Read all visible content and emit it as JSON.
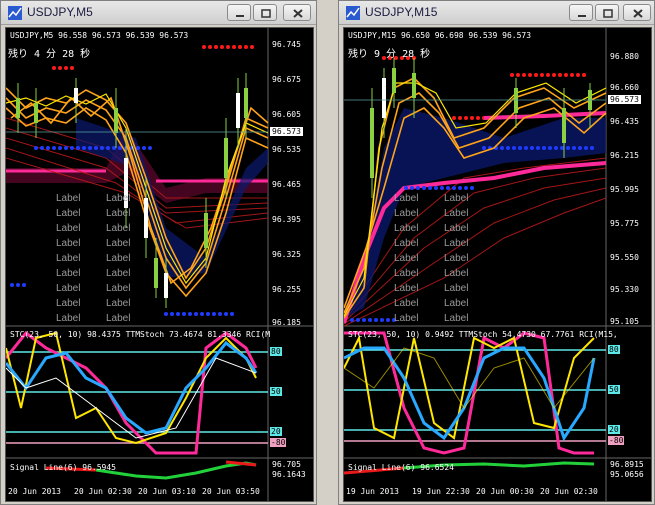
{
  "left": {
    "window_title": "USDJPY,M5",
    "chart_header": "USDJPY,M5  96.558 96.573 96.539 96.573",
    "remaining_time": "残り 4 分 28 秒",
    "price_scale": [
      "96.745",
      "96.675",
      "96.605",
      "96.573",
      "96.535",
      "96.465",
      "96.395",
      "96.325",
      "96.255",
      "96.185"
    ],
    "current_price": "96.573",
    "indicator_header": "STC(23, 50, 10) 98.4375  TTMStoch 73.4674 81.3346  RCI(M",
    "osc_levels": [
      "80",
      "50",
      "20",
      "-80"
    ],
    "signal_header": "Signal Line(6) 96.5945",
    "signal_values": [
      "96.705",
      "96.1643"
    ],
    "time_axis": [
      "20 Jun 2013",
      "20 Jun 02:30",
      "20 Jun 03:10",
      "20 Jun 03:50"
    ],
    "labels": [
      "Label",
      "Label",
      "Label",
      "Label",
      "Label",
      "Label",
      "Label",
      "Label",
      "Label",
      "Label",
      "Label",
      "Label",
      "Label",
      "Label",
      "Label",
      "Label",
      "Label",
      "Label"
    ]
  },
  "right": {
    "window_title": "USDJPY,M15",
    "chart_header": "USDJPY,M15  96.650 96.698 96.539 96.573",
    "remaining_time": "残り 9 分 28 秒",
    "price_scale": [
      "96.880",
      "96.660",
      "96.573",
      "96.435",
      "96.215",
      "95.995",
      "95.775",
      "95.550",
      "95.330",
      "95.105"
    ],
    "current_price": "96.573",
    "indicator_header": "STC(23, 50, 10) 0.9492  TTMStoch 54.4730 67.7761  RCI(M15,",
    "osc_levels": [
      "80",
      "50",
      "20",
      "-80"
    ],
    "signal_header": "Signal Line(6) 96.6524",
    "signal_values": [
      "96.8915",
      "95.0656"
    ],
    "time_axis": [
      "19 Jun 2013",
      "19 Jun 22:30",
      "20 Jun 00:30",
      "20 Jun 02:30"
    ],
    "labels": [
      "Label",
      "Label",
      "Label",
      "Label",
      "Label",
      "Label",
      "Label",
      "Label",
      "Label",
      "Label",
      "Label",
      "Label",
      "Label",
      "Label",
      "Label",
      "Label",
      "Label",
      "Label"
    ]
  },
  "colors": {
    "background": "#000000",
    "orange": "#ffa31a",
    "yellow": "#ffe600",
    "magenta": "#ff2a9a",
    "blue": "#1f3bff",
    "red": "#ff1a1a",
    "cyan": "#5fe8e8",
    "skyblue": "#29a8ff"
  },
  "icons": [
    "chart-app-icon",
    "minimize-icon",
    "restore-icon",
    "close-icon"
  ]
}
